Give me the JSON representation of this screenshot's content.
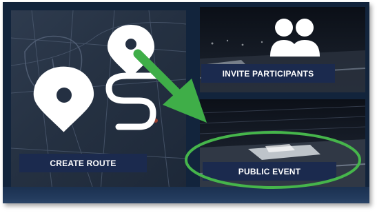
{
  "tiles": {
    "create_route": {
      "label": "CREATE ROUTE"
    },
    "invite_participants": {
      "label": "INVITE PARTICIPANTS"
    },
    "public_event": {
      "label": "PUBLIC EVENT"
    }
  },
  "icons": {
    "route": "route-pins-icon",
    "participants": "participants-icon",
    "annotation_arrow": "green-arrow",
    "annotation_highlight": "green-ellipse"
  },
  "colors": {
    "label_bg": "#1b2a4e",
    "annotation": "#45b649",
    "icon": "#ffffff"
  }
}
